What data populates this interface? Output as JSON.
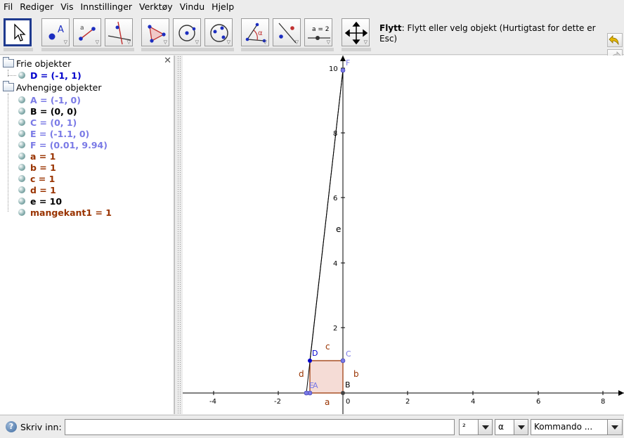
{
  "menu": [
    "Fil",
    "Rediger",
    "Vis",
    "Innstillinger",
    "Verktøy",
    "Vindu",
    "Hjelp"
  ],
  "tooltip": {
    "title": "Flytt",
    "text": ": Flytt eller velg objekt (Hurtigtast for dette er Esc)"
  },
  "tools": {
    "point_label": "A",
    "segment_label": "a",
    "angle_label": "α",
    "slider_label": "a = 2"
  },
  "algebra": {
    "free_header": "Frie objekter",
    "free": [
      {
        "text": "D = (-1, 1)",
        "color": "#0000cc"
      }
    ],
    "dependent_header": "Avhengige objekter",
    "dependent": [
      {
        "text": "A = (-1, 0)",
        "color": "#7a7ae6"
      },
      {
        "text": "B = (0, 0)",
        "color": "#000000"
      },
      {
        "text": "C = (0, 1)",
        "color": "#7a7ae6"
      },
      {
        "text": "E = (-1.1, 0)",
        "color": "#7a7ae6"
      },
      {
        "text": "F = (0.01, 9.94)",
        "color": "#7a7ae6"
      },
      {
        "text": "a = 1",
        "color": "#993300"
      },
      {
        "text": "b = 1",
        "color": "#993300"
      },
      {
        "text": "c = 1",
        "color": "#993300"
      },
      {
        "text": "d = 1",
        "color": "#993300"
      },
      {
        "text": "e = 10",
        "color": "#000000"
      },
      {
        "text": "mangekant1 = 1",
        "color": "#993300"
      }
    ]
  },
  "graphics": {
    "x_ticks": [
      "-4",
      "-2",
      "0",
      "2",
      "4",
      "6",
      "8"
    ],
    "y_ticks": [
      "2",
      "4",
      "6",
      "8",
      "10"
    ],
    "point_labels": [
      "A",
      "B",
      "C",
      "D",
      "E",
      "F"
    ],
    "segment_labels": [
      "a",
      "b",
      "c",
      "d",
      "e"
    ],
    "colors": {
      "free_point": "#0000cc",
      "dep_point": "#7a7ae6",
      "segment": "#993300",
      "polygon_fill": "#f5dcd6"
    }
  },
  "inputbar": {
    "label": "Skriv inn:",
    "value": "",
    "superscript_value": "²",
    "symbol_value": "α",
    "command_value": "Kommando ..."
  }
}
